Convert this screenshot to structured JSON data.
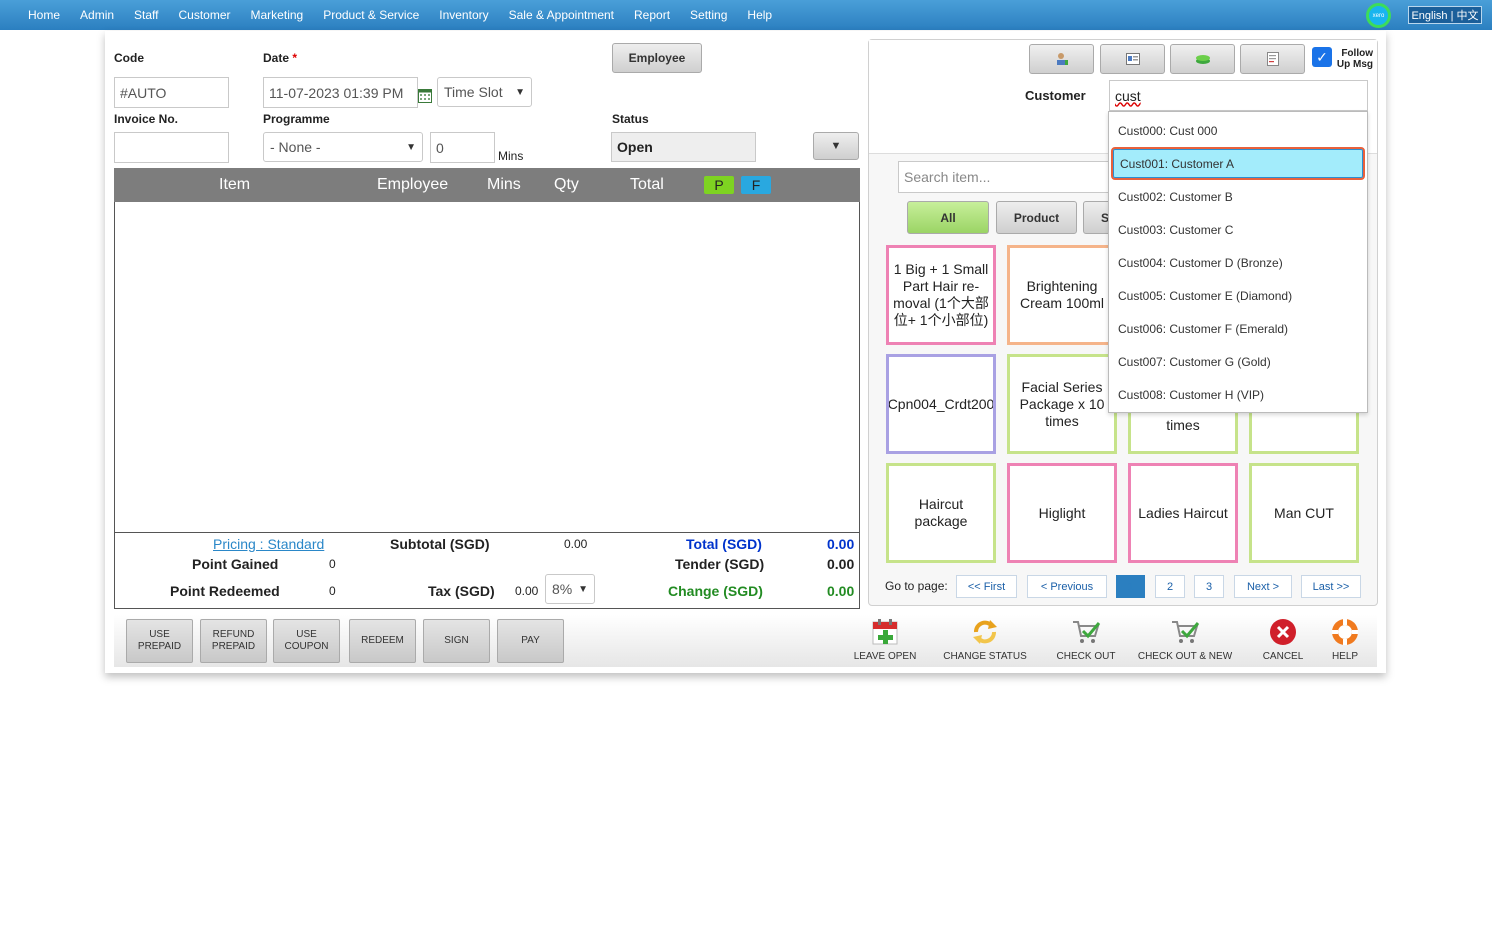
{
  "nav": [
    "Home",
    "Admin",
    "Staff",
    "Customer",
    "Marketing",
    "Product & Service",
    "Inventory",
    "Sale & Appointment",
    "Report",
    "Setting",
    "Help"
  ],
  "xero_label": "xero",
  "language": "English | 中文",
  "form": {
    "code_label": "Code",
    "code_value": "#AUTO",
    "date_label": "Date",
    "date_required": "*",
    "date_value": "11-07-2023 01:39 PM",
    "time_slot": "Time Slot",
    "employee_button": "Employee",
    "invoice_label": "Invoice No.",
    "invoice_value": "",
    "programme_label": "Programme",
    "programme_value": "- None -",
    "mins_value": "0",
    "mins_label": "Mins",
    "status_label": "Status",
    "status_value": "Open"
  },
  "table": {
    "columns": [
      "Item",
      "Employee",
      "Mins",
      "Qty",
      "Total"
    ],
    "badge_p": "P",
    "badge_f": "F"
  },
  "totals": {
    "pricing_link": "Pricing : Standard",
    "subtotal_label": "Subtotal (SGD)",
    "subtotal_value": "0.00",
    "total_label": "Total (SGD)",
    "total_value": "0.00",
    "point_gained_label": "Point Gained",
    "point_gained_value": "0",
    "tender_label": "Tender (SGD)",
    "tender_value": "0.00",
    "point_redeemed_label": "Point Redeemed",
    "point_redeemed_value": "0",
    "tax_label": "Tax (SGD)",
    "tax_value": "0.00",
    "tax_rate": "8%",
    "change_label": "Change (SGD)",
    "change_value": "0.00"
  },
  "actions": [
    "USE\nPREPAID",
    "REFUND\nPREPAID",
    "USE\nCOUPON",
    "REDEEM",
    "SIGN",
    "PAY"
  ],
  "tools": [
    "LEAVE OPEN",
    "CHANGE STATUS",
    "CHECK OUT",
    "CHECK OUT & NEW",
    "CANCEL",
    "HELP"
  ],
  "customer": {
    "follow_up": "Follow\nUp Msg",
    "label": "Customer",
    "search_value": "cust",
    "options": [
      "Cust000: Cust 000",
      "Cust001: Customer A",
      "Cust002: Customer B",
      "Cust003: Customer C",
      "Cust004: Customer D (Bronze)",
      "Cust005: Customer E (Diamond)",
      "Cust006: Customer F (Emerald)",
      "Cust007: Customer G (Gold)",
      "Cust008: Customer H (VIP)"
    ],
    "selected_index": 1
  },
  "items": {
    "search_placeholder": "Search item...",
    "filters": [
      "All",
      "Product",
      "S"
    ],
    "tiles": [
      "1 Big + 1 Small Part Hair re-moval (1个大部位+ 1个小部位)",
      "Brightening Cream 100ml",
      "",
      "",
      "Cpn004_Crdt200",
      "Facial Series Package x 10 times",
      "times",
      "",
      "Haircut package",
      "Higlight",
      "Ladies Haircut",
      "Man CUT"
    ],
    "goto_label": "Go to page:",
    "pager": [
      "<< First",
      "< Previous",
      "1",
      "2",
      "3",
      "Next >",
      "Last >>"
    ],
    "current_page": "1"
  },
  "colors": {
    "nav_bg": "#2b7fc0",
    "total_blue": "#0033cc",
    "change_green": "#228b22",
    "badge_p": "#7ed321",
    "badge_f": "#29a8e0",
    "tile_pink": "#ee82b4",
    "tile_orange": "#f5b48a",
    "tile_purple": "#a9a1e3",
    "tile_green": "#c6e38a",
    "dropdown_highlight": "#a3ecfb"
  }
}
